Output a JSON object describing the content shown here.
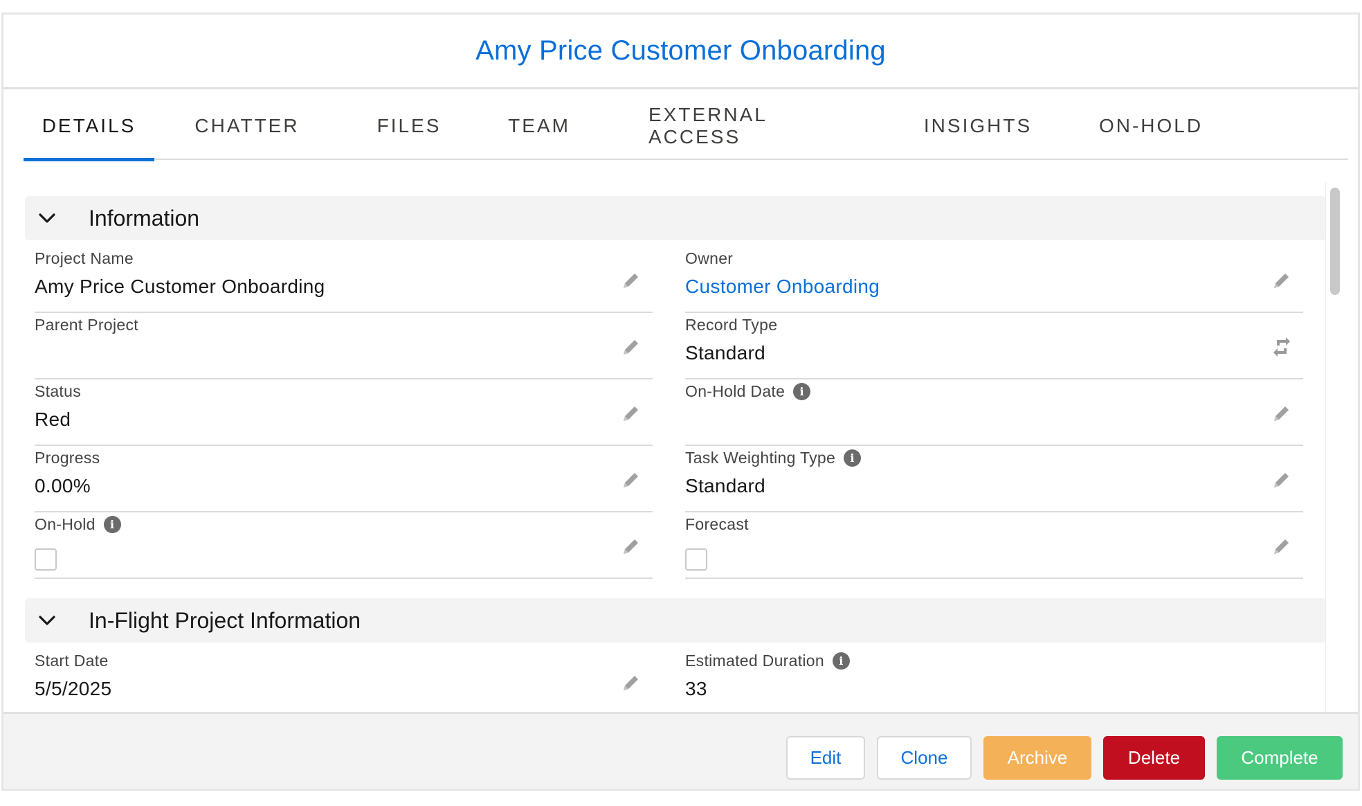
{
  "header": {
    "title": "Amy Price Customer Onboarding"
  },
  "tabs": [
    {
      "label": "DETAILS",
      "active": true
    },
    {
      "label": "CHATTER"
    },
    {
      "label": "FILES"
    },
    {
      "label": "TEAM"
    },
    {
      "label": "EXTERNAL ACCESS"
    },
    {
      "label": "INSIGHTS"
    },
    {
      "label": "ON-HOLD"
    }
  ],
  "sections": {
    "information": {
      "title": "Information",
      "fields": {
        "project_name": {
          "label": "Project Name",
          "value": "Amy Price Customer Onboarding"
        },
        "owner": {
          "label": "Owner",
          "value": "Customer Onboarding"
        },
        "parent_project": {
          "label": "Parent Project",
          "value": ""
        },
        "record_type": {
          "label": "Record Type",
          "value": "Standard"
        },
        "status": {
          "label": "Status",
          "value": "Red"
        },
        "on_hold_date": {
          "label": "On-Hold Date",
          "value": ""
        },
        "progress": {
          "label": "Progress",
          "value": "0.00%"
        },
        "task_weighting_type": {
          "label": "Task Weighting Type",
          "value": "Standard"
        },
        "on_hold": {
          "label": "On-Hold",
          "checked": false
        },
        "forecast": {
          "label": "Forecast",
          "checked": false
        }
      }
    },
    "in_flight": {
      "title": "In-Flight Project Information",
      "fields": {
        "start_date": {
          "label": "Start Date",
          "value": "5/5/2025"
        },
        "estimated_duration": {
          "label": "Estimated Duration",
          "value": "33"
        }
      }
    }
  },
  "footer": {
    "edit": "Edit",
    "clone": "Clone",
    "archive": "Archive",
    "delete": "Delete",
    "complete": "Complete"
  },
  "colors": {
    "brand": "#0b6fd8",
    "archive": "#f5b158",
    "delete": "#c10f1f",
    "complete": "#4bca7f"
  },
  "icons": {
    "info": "i",
    "chevron": "chevron-down-icon",
    "edit": "pencil-icon",
    "change_record_type": "swap-icon"
  }
}
